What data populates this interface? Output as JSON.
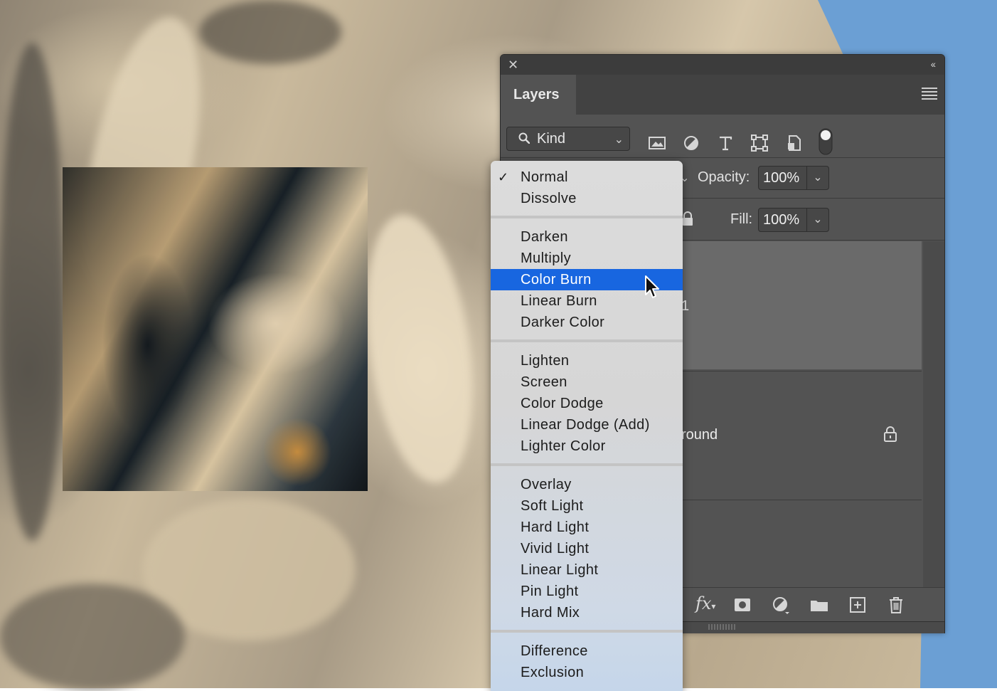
{
  "panel": {
    "tab_label": "Layers",
    "filter": {
      "kind_label": "Kind"
    },
    "opacity_label": "Opacity:",
    "opacity_value": "100%",
    "fill_label": "Fill:",
    "fill_value": "100%",
    "layers": [
      {
        "label_fragment": "1",
        "selected": true
      },
      {
        "label_fragment": "round",
        "locked": true
      }
    ],
    "bottom_toolbar_icons": [
      "fx-icon",
      "layer-mask-icon",
      "adjustment-layer-icon",
      "new-group-folder-icon",
      "new-layer-icon",
      "trash-icon"
    ]
  },
  "blend_menu": {
    "checked_item": "Normal",
    "highlighted_item": "Color Burn",
    "groups": [
      [
        "Normal",
        "Dissolve"
      ],
      [
        "Darken",
        "Multiply",
        "Color Burn",
        "Linear Burn",
        "Darker Color"
      ],
      [
        "Lighten",
        "Screen",
        "Color Dodge",
        "Linear Dodge (Add)",
        "Lighter Color"
      ],
      [
        "Overlay",
        "Soft Light",
        "Hard Light",
        "Vivid Light",
        "Linear Light",
        "Pin Light",
        "Hard Mix"
      ],
      [
        "Difference",
        "Exclusion"
      ]
    ]
  },
  "colors": {
    "panel_bg": "#535353",
    "selected_layer_bg": "#6a6a6a",
    "menu_highlight": "#1866e0",
    "sky": "#6b9fd4"
  }
}
